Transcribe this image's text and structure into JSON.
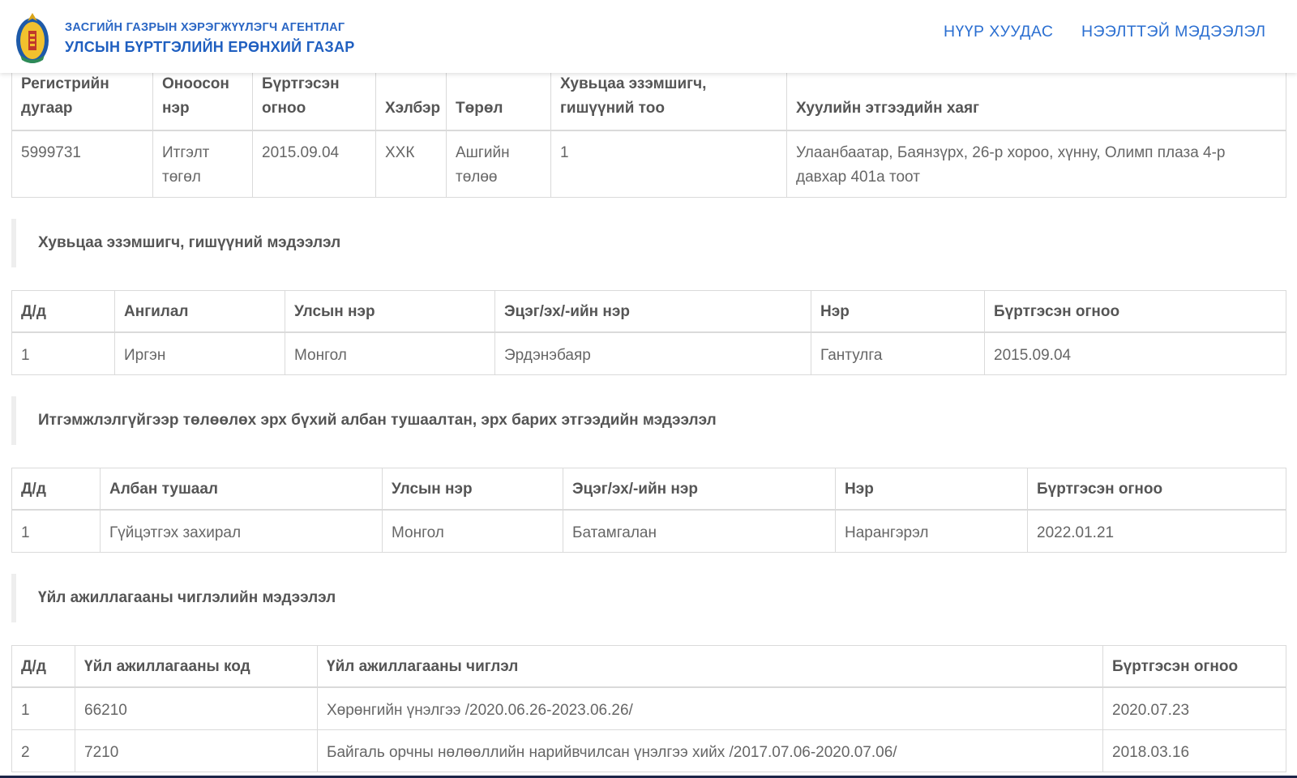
{
  "header": {
    "agency_line": "ЗАСГИЙН ГАЗРЫН ХЭРЭГЖҮҮЛЭГЧ АГЕНТЛАГ",
    "org_name": "УЛСЫН БҮРТГЭЛИЙН ЕРӨНХИЙ ГАЗАР",
    "nav": [
      "НҮҮР ХУУДАС",
      "НЭЭЛТТЭЙ МЭДЭЭЛЭЛ"
    ]
  },
  "entity": {
    "headers": [
      "Регистрийн дугаар",
      "Оноосон нэр",
      "Бүртгэсэн огноо",
      "Хэлбэр",
      "Төрөл",
      "Хувьцаа эзэмшигч, гишүүний тоо",
      "Хуулийн этгээдийн хаяг"
    ],
    "row": [
      "5999731",
      "Итгэлт төгөл",
      "2015.09.04",
      "ХХК",
      "Ашгийн төлөө",
      "1",
      "Улаанбаатар, Баянзүрх, 26-р хороо, хүнну, Олимп плаза 4-р давхар 401а тоот"
    ]
  },
  "shareholders": {
    "title": "Хувьцаа эзэмшигч, гишүүний мэдээлэл",
    "headers": [
      "Д/д",
      "Ангилал",
      "Улсын нэр",
      "Эцэг/эх/-ийн нэр",
      "Нэр",
      "Бүртгэсэн огноо"
    ],
    "rows": [
      [
        "1",
        "Иргэн",
        "Монгол",
        "Эрдэнэбаяр",
        "Гантулга",
        "2015.09.04"
      ]
    ]
  },
  "officials": {
    "title": "Итгэмжлэлгүйгээр төлөөлөх эрх бүхий албан тушаалтан, эрх барих этгээдийн мэдээлэл",
    "headers": [
      "Д/д",
      "Албан тушаал",
      "Улсын нэр",
      "Эцэг/эх/-ийн нэр",
      "Нэр",
      "Бүртгэсэн огноо"
    ],
    "rows": [
      [
        "1",
        "Гүйцэтгэх захирал",
        "Монгол",
        "Батамгалан",
        "Нарангэрэл",
        "2022.01.21"
      ]
    ]
  },
  "activities": {
    "title": "Үйл ажиллагааны чиглэлийн мэдээлэл",
    "headers": [
      "Д/д",
      "Үйл ажиллагааны код",
      "Үйл ажиллагааны чиглэл",
      "Бүртгэсэн огноо"
    ],
    "rows": [
      [
        "1",
        "66210",
        "Хөрөнгийн үнэлгээ /2020.06.26-2023.06.26/",
        "2020.07.23"
      ],
      [
        "2",
        "7210",
        "Байгаль орчны нөлөөллийн нарийвчилсан үнэлгээ хийх /2017.07.06-2020.07.06/",
        "2018.03.16"
      ]
    ]
  },
  "colors": {
    "brand": "#1f5fc0",
    "nav": "#2b6fd1",
    "border": "#dadada"
  }
}
